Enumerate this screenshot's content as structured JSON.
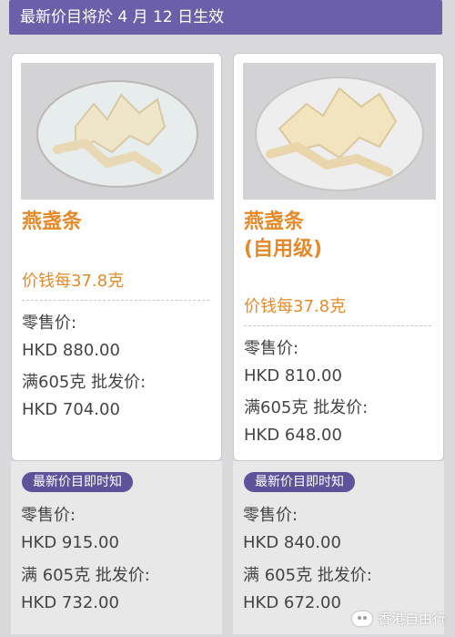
{
  "banner": {
    "text": "最新价目将於 4 月 12 日生效"
  },
  "products": [
    {
      "name_line1": "燕盏条",
      "name_line2": "",
      "unit_label": "价钱每37.8克",
      "retail_label": "零售价:",
      "retail_price": "HKD 880.00",
      "wholesale_label": "满605克 批发价:",
      "wholesale_price": "HKD 704.00",
      "new_badge": "最新价目即时知",
      "new_retail_label": "零售价:",
      "new_retail_price": "HKD 915.00",
      "new_wholesale_label": "满 605克 批发价:",
      "new_wholesale_price": "HKD 732.00"
    },
    {
      "name_line1": "燕盏条",
      "name_line2": "(自用级)",
      "unit_label": "价钱每37.8克",
      "retail_label": "零售价:",
      "retail_price": "HKD 810.00",
      "wholesale_label": "满605克 批发价:",
      "wholesale_price": "HKD 648.00",
      "new_badge": "最新价目即时知",
      "new_retail_label": "零售价:",
      "new_retail_price": "HKD 840.00",
      "new_wholesale_label": "满 605克 批发价:",
      "new_wholesale_price": "HKD 672.00"
    }
  ],
  "watermark": {
    "text": "香港自由行"
  },
  "colors": {
    "accent": "#6a5fa8",
    "orange": "#e48a2a"
  }
}
